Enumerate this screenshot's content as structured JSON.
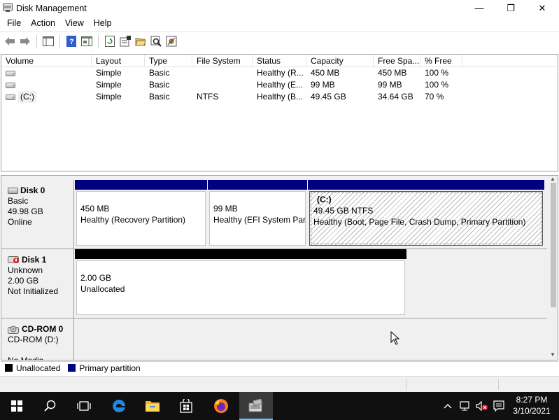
{
  "window": {
    "title": "Disk Management",
    "controls": {
      "minimize": "—",
      "maximize": "❐",
      "close": "✕"
    }
  },
  "menu": [
    "File",
    "Action",
    "View",
    "Help"
  ],
  "toolbar_icons": [
    "back-arrow-icon",
    "forward-arrow-icon",
    "console-tree-icon",
    "help-icon",
    "action-pane-icon",
    "refresh-icon",
    "properties-icon",
    "open-folder-icon",
    "search-icon",
    "settings-icon"
  ],
  "volume_list": {
    "columns": [
      "Volume",
      "Layout",
      "Type",
      "File System",
      "Status",
      "Capacity",
      "Free Spa...",
      "% Free"
    ],
    "rows": [
      {
        "volume": "",
        "layout": "Simple",
        "type": "Basic",
        "fs": "",
        "status": "Healthy (R...",
        "capacity": "450 MB",
        "free": "450 MB",
        "pct": "100 %"
      },
      {
        "volume": "",
        "layout": "Simple",
        "type": "Basic",
        "fs": "",
        "status": "Healthy (E...",
        "capacity": "99 MB",
        "free": "99 MB",
        "pct": "100 %"
      },
      {
        "volume": "(C:)",
        "layout": "Simple",
        "type": "Basic",
        "fs": "NTFS",
        "status": "Healthy (B...",
        "capacity": "49.45 GB",
        "free": "34.64 GB",
        "pct": "70 %"
      }
    ]
  },
  "disks": [
    {
      "name": "Disk 0",
      "type": "Basic",
      "size": "49.98 GB",
      "state": "Online",
      "partitions": [
        {
          "title": "",
          "size": "450 MB",
          "status": "Healthy (Recovery Partition)"
        },
        {
          "title": "",
          "size": "99 MB",
          "status": "Healthy (EFI System Part"
        },
        {
          "title": "(C:)",
          "size": "49.45 GB NTFS",
          "status": "Healthy (Boot, Page File, Crash Dump, Primary Partition)"
        }
      ]
    },
    {
      "name": "Disk 1",
      "type": "Unknown",
      "size": "2.00 GB",
      "state": "Not Initialized",
      "partitions": [
        {
          "size": "2.00 GB",
          "status": "Unallocated"
        }
      ]
    },
    {
      "name": "CD-ROM 0",
      "type": "CD-ROM (D:)",
      "state": "No Media"
    }
  ],
  "legend": [
    {
      "label": "Unallocated",
      "color": "#000000"
    },
    {
      "label": "Primary partition",
      "color": "#000080"
    }
  ],
  "colors": {
    "primary_bar": "#000080",
    "unallocated_bar": "#000000",
    "taskbar": "#101010",
    "active_accent": "#76b9ed"
  },
  "taskbar": {
    "apps": [
      "start-icon",
      "search-icon",
      "task-view-icon",
      "edge-icon",
      "file-explorer-icon",
      "store-icon",
      "firefox-icon",
      "disk-management-icon"
    ],
    "time": "8:27 PM",
    "date": "3/10/2021"
  }
}
